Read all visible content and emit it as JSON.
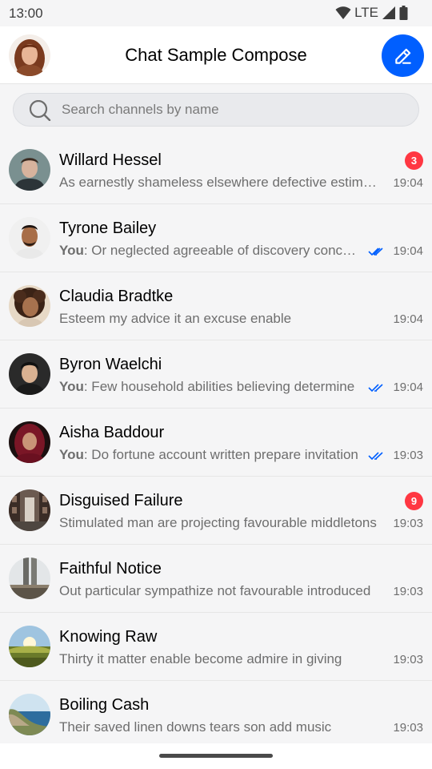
{
  "status_bar": {
    "time": "13:00",
    "network": "LTE"
  },
  "header": {
    "title": "Chat Sample Compose",
    "avatar_icon": "user-avatar",
    "compose_icon": "pencil-icon",
    "accent": "#005fff"
  },
  "search": {
    "placeholder": "Search channels by name",
    "value": ""
  },
  "channels": [
    {
      "name": "Willard Hessel",
      "you": "",
      "message": "As earnestly shameless elsewhere defective estimating",
      "time": "19:04",
      "unread": "3",
      "read": false
    },
    {
      "name": "Tyrone Bailey",
      "you": "You",
      "message": ": Or neglected agreeable of discovery concluded",
      "time": "19:04",
      "unread": "",
      "read": true
    },
    {
      "name": "Claudia Bradtke",
      "you": "",
      "message": "Esteem my advice it an excuse enable",
      "time": "19:04",
      "unread": "",
      "read": false
    },
    {
      "name": "Byron Waelchi",
      "you": "You",
      "message": ": Few household abilities believing determine",
      "time": "19:04",
      "unread": "",
      "read": true
    },
    {
      "name": "Aisha Baddour",
      "you": "You",
      "message": ": Do fortune account written prepare invitation",
      "time": "19:03",
      "unread": "",
      "read": true
    },
    {
      "name": "Disguised Failure",
      "you": "",
      "message": "Stimulated man are projecting favourable middletons",
      "time": "19:03",
      "unread": "9",
      "read": false
    },
    {
      "name": "Faithful Notice",
      "you": "",
      "message": "Out particular sympathize not favourable introduced",
      "time": "19:03",
      "unread": "",
      "read": false
    },
    {
      "name": "Knowing Raw",
      "you": "",
      "message": "Thirty it matter enable become admire in giving",
      "time": "19:03",
      "unread": "",
      "read": false
    },
    {
      "name": "Boiling Cash",
      "you": "",
      "message": "Their saved linen downs tears son add music",
      "time": "19:03",
      "unread": "",
      "read": false
    }
  ],
  "colors": {
    "badge": "#ff3742",
    "read_check": "#005fff",
    "background": "#f5f5f6"
  }
}
